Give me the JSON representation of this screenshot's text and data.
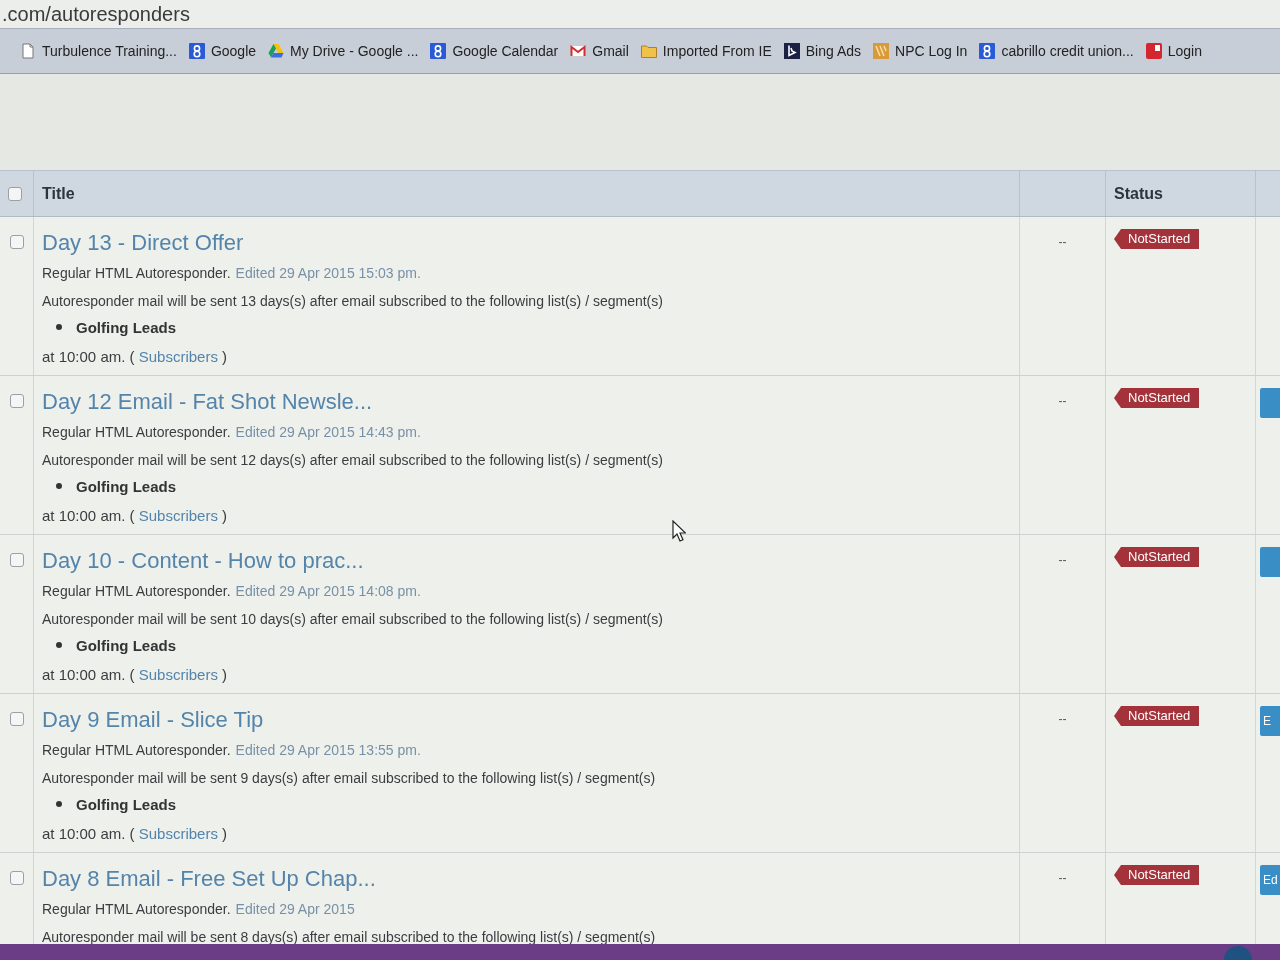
{
  "address_bar": {
    "url": ".com/autoresponders"
  },
  "bookmarks": [
    {
      "label": "Turbulence Training...",
      "kind": "page"
    },
    {
      "label": "Google",
      "kind": "g"
    },
    {
      "label": "My Drive - Google ...",
      "kind": "drive"
    },
    {
      "label": "Google Calendar",
      "kind": "g"
    },
    {
      "label": "Gmail",
      "kind": "mail"
    },
    {
      "label": "Imported From IE",
      "kind": "folder"
    },
    {
      "label": "Bing Ads",
      "kind": "bing"
    },
    {
      "label": "NPC Log In",
      "kind": "npc"
    },
    {
      "label": "cabrillo credit union...",
      "kind": "g"
    },
    {
      "label": "Login",
      "kind": "login"
    }
  ],
  "table": {
    "header_checkbox": {
      "checked": false
    },
    "columns": {
      "title": "Title",
      "status": "Status"
    },
    "rows": [
      {
        "checked": false,
        "title": "Day 13 - Direct Offer",
        "type": "Regular HTML Autoresponder.",
        "edited": "Edited 29 Apr 2015 15:03 pm.",
        "schedule": "Autoresponder mail will be sent 13 days(s) after email subscribed to the following list(s) / segment(s)",
        "lists": [
          "Golfing Leads"
        ],
        "time": {
          "before": "at 10:00 am. (",
          "link": "Subscribers",
          "after": ")"
        },
        "column_3": "--",
        "status": "NotStarted",
        "action_button": false
      },
      {
        "checked": false,
        "title": "Day 12 Email - Fat Shot Newsle...",
        "type": "Regular HTML Autoresponder.",
        "edited": "Edited 29 Apr 2015 14:43 pm.",
        "schedule": "Autoresponder mail will be sent 12 days(s) after email subscribed to the following list(s) / segment(s)",
        "lists": [
          "Golfing Leads"
        ],
        "time": {
          "before": "at 10:00 am. (",
          "link": "Subscribers",
          "after": ")"
        },
        "column_3": "--",
        "status": "NotStarted",
        "action_button": true
      },
      {
        "checked": false,
        "title": "Day 10 - Content - How to prac...",
        "type": "Regular HTML Autoresponder.",
        "edited": "Edited 29 Apr 2015 14:08 pm.",
        "schedule": "Autoresponder mail will be sent 10 days(s) after email subscribed to the following list(s) / segment(s)",
        "lists": [
          "Golfing Leads"
        ],
        "time": {
          "before": "at 10:00 am. (",
          "link": "Subscribers",
          "after": ")"
        },
        "column_3": "--",
        "status": "NotStarted",
        "action_button": true
      },
      {
        "checked": false,
        "title": "Day 9 Email - Slice Tip",
        "type": "Regular HTML Autoresponder.",
        "edited": "Edited 29 Apr 2015 13:55 pm.",
        "schedule": "Autoresponder mail will be sent 9 days(s) after email subscribed to the following list(s) / segment(s)",
        "lists": [
          "Golfing Leads"
        ],
        "time": {
          "before": "at 10:00 am. (",
          "link": "Subscribers",
          "after": ")"
        },
        "column_3": "--",
        "status": "NotStarted",
        "action_button": true,
        "action_label": "E"
      },
      {
        "checked": false,
        "title": "Day 8 Email - Free Set Up Chap...",
        "type": "Regular HTML Autoresponder.",
        "edited": "Edited 29 Apr 2015",
        "schedule": "Autoresponder mail will be sent 8 days(s) after email subscribed to the following list(s) / segment(s)",
        "column_3": "--",
        "status": "NotStarted",
        "action_button": true,
        "action_label": "Ed"
      }
    ]
  }
}
